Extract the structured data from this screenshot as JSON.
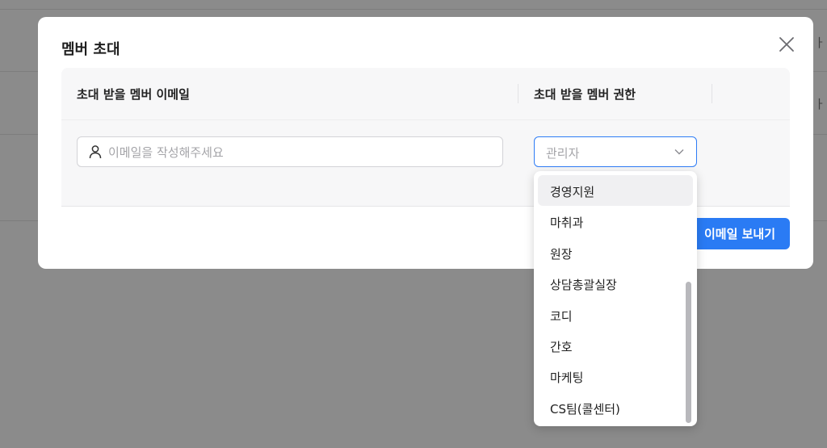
{
  "modal": {
    "title": "멤버 초대",
    "close_icon": "close-icon"
  },
  "table": {
    "col_email_header": "초대 받을 멤버 이메일",
    "col_role_header": "초대 받을 멤버 권한"
  },
  "email_field": {
    "value": "",
    "placeholder": "이메일을 작성해주세요",
    "icon": "user-icon"
  },
  "role_select": {
    "placeholder": "관리자",
    "icon": "chevron-down-icon"
  },
  "send_button": {
    "label": "이메일 보내기"
  },
  "dropdown": {
    "items": [
      "경영지원",
      "마취과",
      "원장",
      "상담총괄실장",
      "코디",
      "간호",
      "마케팅",
      "CS팀(콜센터)"
    ],
    "highlighted": "경영지원"
  },
  "background": {
    "fragment_1": "ㅏ",
    "fragment_2": "ㅏ"
  },
  "colors": {
    "accent": "#2a7bf4",
    "overlay": "#8b8b8b"
  }
}
